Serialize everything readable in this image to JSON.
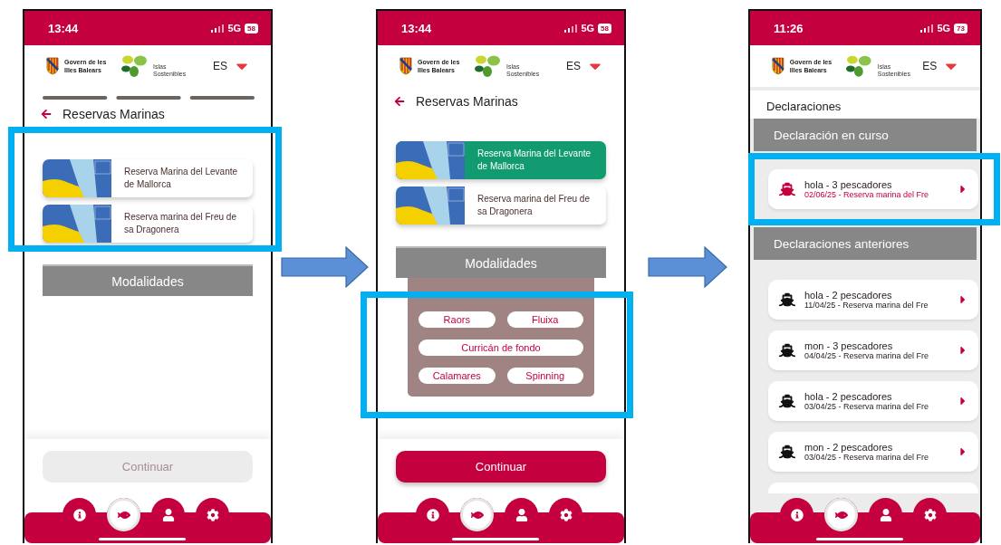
{
  "phones": [
    {
      "kind": "reserves",
      "status": {
        "time": "13:44",
        "network": "5G",
        "battery": "58"
      },
      "header": {
        "brand": [
          "Govern de les",
          "Illes Balears"
        ],
        "partner": [
          "Islas",
          "Sostenibles"
        ],
        "language": "ES"
      },
      "progress": true,
      "title": "Reservas Marinas",
      "reserves": [
        {
          "name": "Reserva Marina del Levante de Mallorca",
          "selected": false
        },
        {
          "name": "Reserva marina del Freu de sa Dragonera",
          "selected": false
        }
      ],
      "section": "Modalidades",
      "continue": {
        "label": "Continuar",
        "disabled": true
      },
      "nav": [
        {
          "kind": "info",
          "selected": false
        },
        {
          "kind": "fish",
          "selected": true
        },
        {
          "kind": "user",
          "selected": false
        },
        {
          "kind": "settings",
          "selected": false
        }
      ]
    },
    {
      "kind": "reserves",
      "status": {
        "time": "13:44",
        "network": "5G",
        "battery": "58"
      },
      "header": {
        "brand": [
          "Govern de les",
          "Illes Balears"
        ],
        "partner": [
          "Islas",
          "Sostenibles"
        ],
        "language": "ES"
      },
      "progress": false,
      "title": "Reservas Marinas",
      "reserves": [
        {
          "name": "Reserva Marina del Levante de Mallorca",
          "selected": true
        },
        {
          "name": "Reserva marina del Freu de sa Dragonera",
          "selected": false
        }
      ],
      "section": "Modalidades",
      "modalities": [
        [
          "Raors",
          "Fluixa"
        ],
        [
          "Curricán de fondo"
        ],
        [
          "Calamares",
          "Spinning"
        ]
      ],
      "continue": {
        "label": "Continuar",
        "disabled": false
      },
      "nav": [
        {
          "kind": "info",
          "selected": false
        },
        {
          "kind": "fish",
          "selected": true
        },
        {
          "kind": "user",
          "selected": false
        },
        {
          "kind": "settings",
          "selected": false
        }
      ]
    },
    {
      "kind": "declarations",
      "status": {
        "time": "11:26",
        "network": "5G",
        "battery": "73"
      },
      "header": {
        "brand": [
          "Govern de les",
          "Illes Balears"
        ],
        "partner": [
          "Islas",
          "Sostenibles"
        ],
        "language": "ES"
      },
      "title": "Declaraciones",
      "sections": [
        {
          "heading": "Declaración en curso",
          "items": [
            {
              "title": "hola - 3 pescadores",
              "subtitle": "02/06/25 - Reserva marina del Fre",
              "current": true
            }
          ]
        },
        {
          "heading": "Declaraciones anteriores",
          "items": [
            {
              "title": "hola - 2 pescadores",
              "subtitle": "11/04/25 - Reserva marina del Fre",
              "current": false
            },
            {
              "title": "mon - 3 pescadores",
              "subtitle": "04/04/25 - Reserva marina del Fre",
              "current": false
            },
            {
              "title": "hola - 2 pescadores",
              "subtitle": "03/04/25 - Reserva marina del Fre",
              "current": false
            },
            {
              "title": "mon - 2 pescadores",
              "subtitle": "03/04/25 - Reserva marina del Fre",
              "current": false
            }
          ]
        }
      ],
      "nav": [
        {
          "kind": "info",
          "selected": false
        },
        {
          "kind": "fish",
          "selected": true
        },
        {
          "kind": "user",
          "selected": false
        },
        {
          "kind": "settings",
          "selected": false
        }
      ]
    }
  ]
}
